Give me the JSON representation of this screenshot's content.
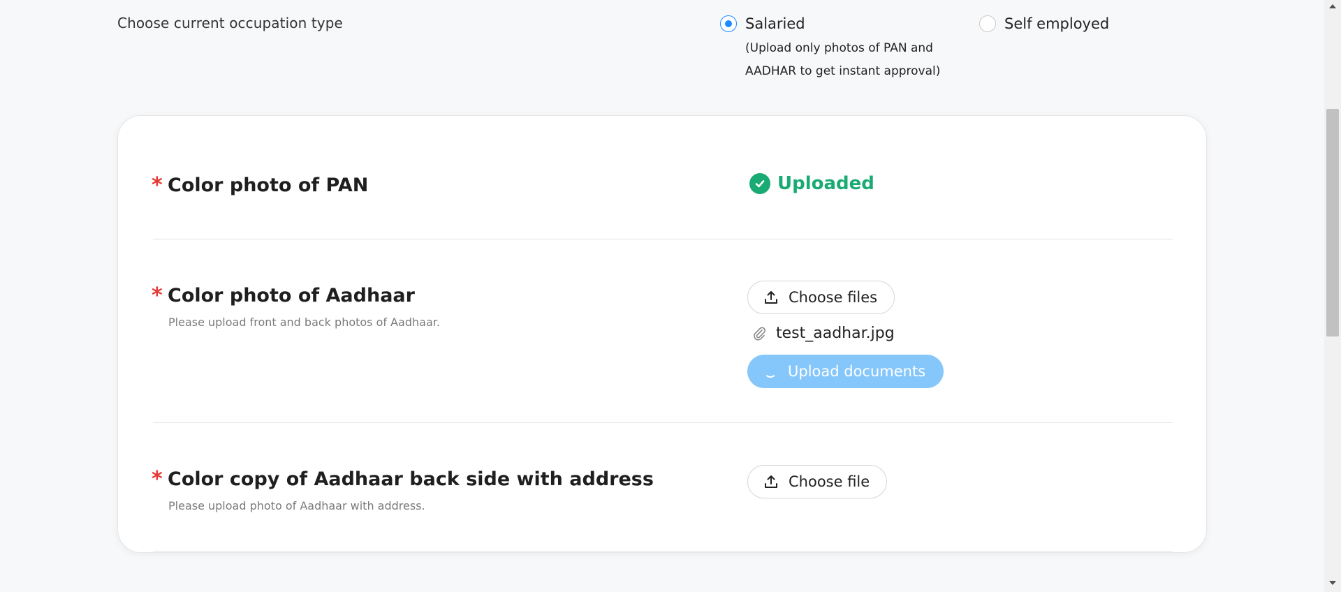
{
  "occupation": {
    "label": "Choose current occupation type",
    "options": [
      {
        "label": "Salaried",
        "selected": true,
        "note": "(Upload only photos of PAN and AADHAR to get instant approval)"
      },
      {
        "label": "Self employed",
        "selected": false
      }
    ]
  },
  "documents": [
    {
      "required_mark": "*",
      "title": "Color photo of PAN",
      "status": "Uploaded"
    },
    {
      "required_mark": "*",
      "title": "Color photo of Aadhaar",
      "hint": "Please upload front and back photos of Aadhaar.",
      "choose_label": "Choose files",
      "selected_file": "test_aadhar.jpg",
      "upload_label": "Upload documents"
    },
    {
      "required_mark": "*",
      "title": "Color copy of Aadhaar back side with address",
      "hint": "Please upload photo of Aadhaar with address.",
      "choose_label": "Choose file"
    }
  ],
  "colors": {
    "accent": "#1a8cff",
    "success": "#1aaa73",
    "required": "#e53935",
    "upload_button_loading": "#86c7fb"
  },
  "icons": [
    "check-circle-icon",
    "upload-icon",
    "paperclip-icon",
    "spinner-icon"
  ]
}
